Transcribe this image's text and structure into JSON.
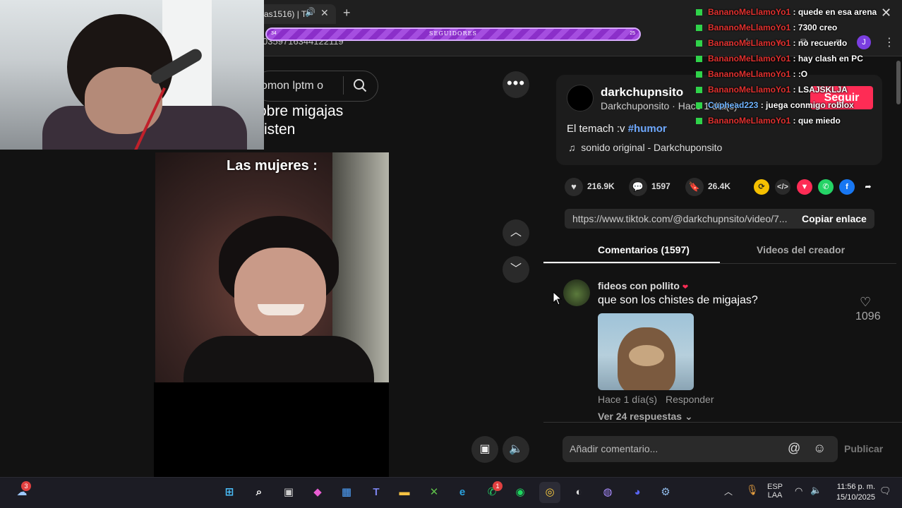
{
  "browser": {
    "tab_title": "as1516) | Ti",
    "url_fragment": "0359716344122119"
  },
  "followers_bar": {
    "label": "SEGUIDORES",
    "left_value": "34",
    "right_value": "25",
    "progress": 1.0
  },
  "tiktok": {
    "search_text": "omon lptm o",
    "feed_text_line1": "obre migajas",
    "feed_text_line2": "isten",
    "video_caption": "Las mujeres :",
    "author": {
      "username": "darkchupnsito",
      "subtitle": "Darkchuponsito · Hace 1 día(s)",
      "follow_label": "Seguir"
    },
    "description_text": "El temach :v ",
    "description_tag": "#humor",
    "music": "sonido original - Darkchuponsito",
    "stats": {
      "likes": "216.9K",
      "comments": "1597",
      "saves": "26.4K"
    },
    "link": "https://www.tiktok.com/@darkchupnsito/video/7...",
    "copy_label": "Copiar enlace",
    "tabs": {
      "comments": "Comentarios (1597)",
      "videos": "Videos del creador"
    },
    "comment": {
      "user": "fideos con pollito",
      "text": "que son los chistes de migajas?",
      "likes": "1096",
      "time": "Hace 1 día(s)",
      "reply_label": "Responder",
      "more_replies": "Ver 24 respuestas"
    },
    "add_comment_placeholder": "Añadir comentario...",
    "publish_label": "Publicar"
  },
  "chat": [
    {
      "user": "BananoMeLlamoYo1",
      "msg": ": quede en esa arena",
      "color": "#e0312f"
    },
    {
      "user": "BananoMeLlamoYo1",
      "msg": ": 7300 creo",
      "color": "#e0312f"
    },
    {
      "user": "BananoMeLlamoYo1",
      "msg": ": no recuerdo",
      "color": "#e0312f"
    },
    {
      "user": "BananoMeLlamoYo1",
      "msg": ": hay clash en PC",
      "color": "#e0312f"
    },
    {
      "user": "BananoMeLlamoYo1",
      "msg": ": :O",
      "color": "#e0312f"
    },
    {
      "user": "BananoMeLlamoYo1",
      "msg": ": LSAJSKLJA",
      "color": "#e0312f"
    },
    {
      "user": "Cuphead223",
      "msg": ": juega conmigo roblox",
      "color": "#6fb4ff"
    },
    {
      "user": "BananoMeLlamoYo1",
      "msg": ": que miedo",
      "color": "#e0312f"
    }
  ],
  "taskbar": {
    "weather_badge": "3",
    "whatsapp_badge": "1",
    "lang_top": "ESP",
    "lang_bottom": "LAA",
    "time": "11:56 p. m.",
    "date": "15/10/2025"
  },
  "colors": {
    "accent": "#fe2c55",
    "hashtag": "#6ea8fe",
    "chat_user": "#e0312f",
    "chat_user_alt": "#6fb4ff"
  }
}
